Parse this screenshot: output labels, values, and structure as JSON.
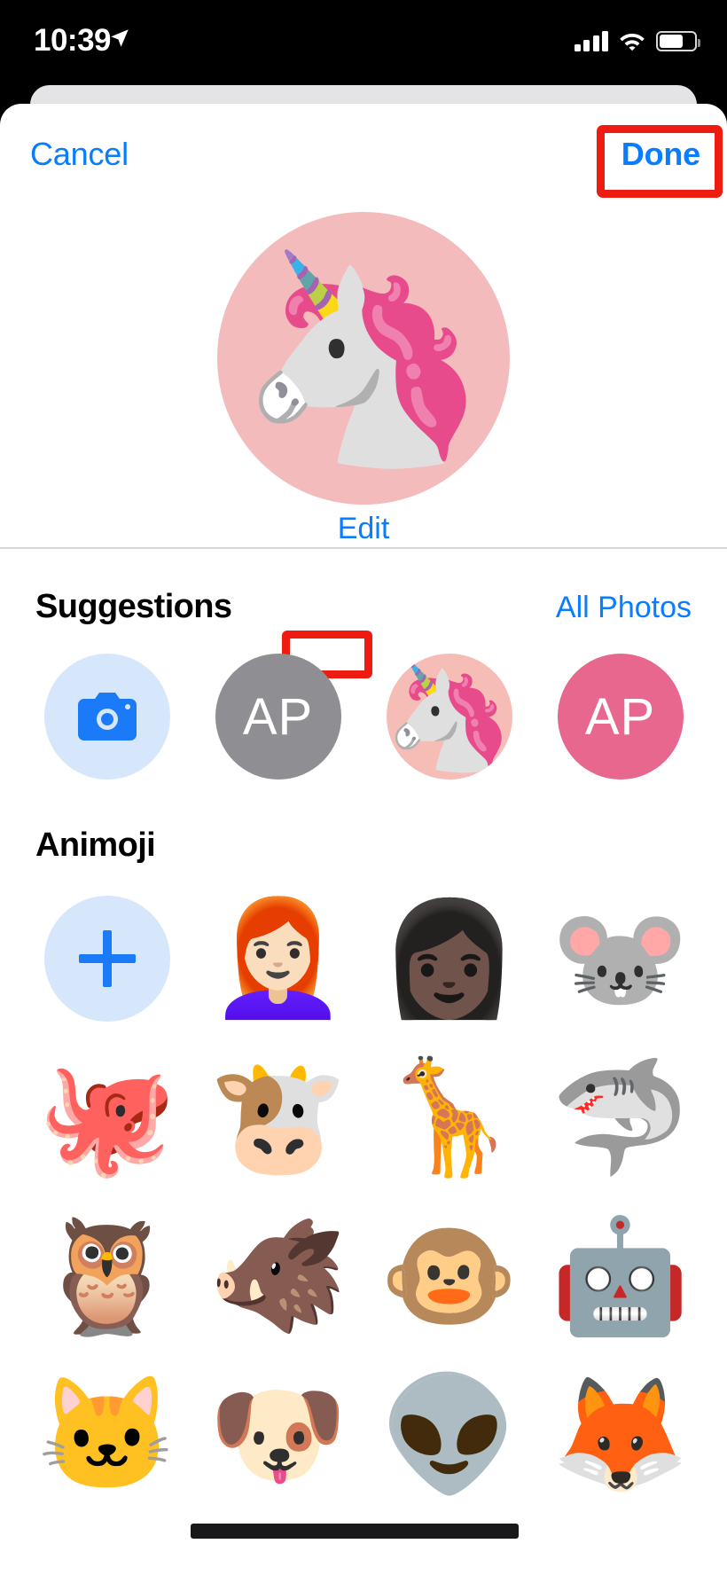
{
  "status_bar": {
    "time": "10:39",
    "location_icon": "location-arrow-icon",
    "cellular_icon": "signal-bars-icon",
    "wifi_icon": "wifi-icon",
    "battery_icon": "battery-icon"
  },
  "navbar": {
    "cancel_label": "Cancel",
    "done_label": "Done",
    "highlight_color": "#ee1b11"
  },
  "avatar": {
    "glyph": "🦄",
    "background_color": "#f3bbbb",
    "edit_label": "Edit",
    "name": "unicorn-animoji"
  },
  "suggestions": {
    "title": "Suggestions",
    "action_label": "All Photos",
    "items": [
      {
        "name": "camera-option",
        "kind": "icon",
        "icon": "camera-icon",
        "bg": "#d7e7fb",
        "label": ""
      },
      {
        "name": "initials-grey-option",
        "kind": "initials",
        "bg": "#8e8e93",
        "label": "AP"
      },
      {
        "name": "unicorn-photo-option",
        "kind": "moji",
        "bg": "#f6bdb6",
        "glyph": "🦄",
        "label": ""
      },
      {
        "name": "initials-pink-option",
        "kind": "initials",
        "bg": "#e8678e",
        "label": "AP"
      }
    ]
  },
  "animoji": {
    "title": "Animoji",
    "items": [
      {
        "name": "add-animoji",
        "kind": "icon",
        "icon": "plus-icon",
        "bg": "#d7e7fb",
        "glyph": ""
      },
      {
        "name": "memoji-glasses-bun",
        "kind": "moji",
        "glyph": "👩🏻‍🦰"
      },
      {
        "name": "memoji-hat-braids",
        "kind": "moji",
        "glyph": "👩🏿"
      },
      {
        "name": "mouse-animoji",
        "kind": "moji",
        "glyph": "🐭"
      },
      {
        "name": "octopus-animoji",
        "kind": "moji",
        "glyph": "🐙"
      },
      {
        "name": "cow-animoji",
        "kind": "moji",
        "glyph": "🐮"
      },
      {
        "name": "giraffe-animoji",
        "kind": "moji",
        "glyph": "🦒"
      },
      {
        "name": "shark-animoji",
        "kind": "moji",
        "glyph": "🦈"
      },
      {
        "name": "owl-animoji",
        "kind": "moji",
        "glyph": "🦉"
      },
      {
        "name": "boar-animoji",
        "kind": "moji",
        "glyph": "🐗"
      },
      {
        "name": "monkey-animoji",
        "kind": "moji",
        "glyph": "🐵"
      },
      {
        "name": "robot-animoji",
        "kind": "moji",
        "glyph": "🤖"
      },
      {
        "name": "cat-animoji",
        "kind": "moji",
        "glyph": "🐱"
      },
      {
        "name": "dog-animoji",
        "kind": "moji",
        "glyph": "🐶"
      },
      {
        "name": "alien-animoji",
        "kind": "moji",
        "glyph": "👽"
      },
      {
        "name": "fox-animoji",
        "kind": "moji",
        "glyph": "🦊"
      }
    ]
  }
}
